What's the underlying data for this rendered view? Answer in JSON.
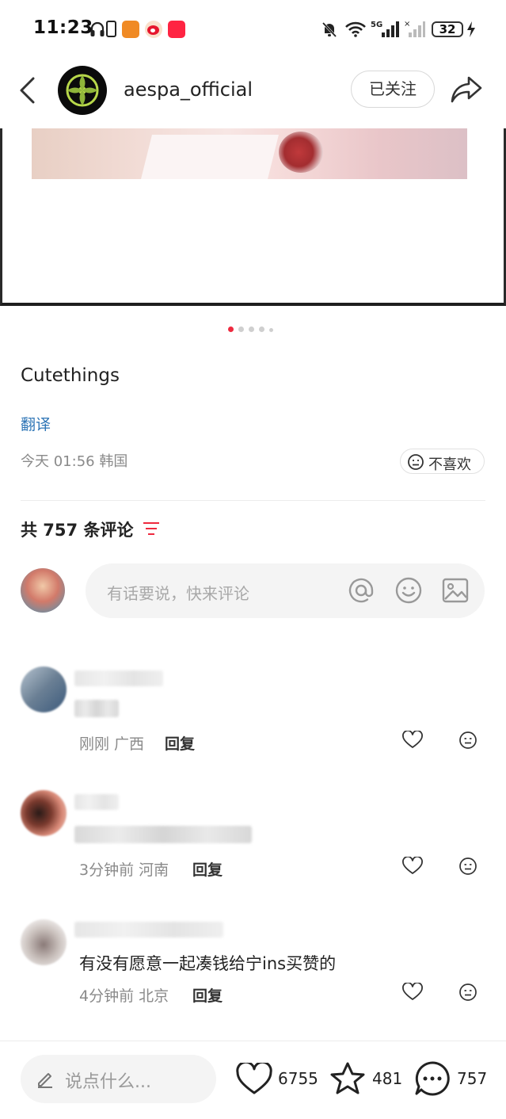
{
  "status_bar": {
    "time": "11:23",
    "battery": "32",
    "left_icons": [
      "headphones-icon",
      "battery-saver-icon",
      "app-notification-icon",
      "weibo-icon",
      "xiaohongshu-icon"
    ],
    "right_icons": [
      "mute-bell-icon",
      "wifi-icon",
      "signal-5g-icon",
      "signal-no-service-icon",
      "charging-icon"
    ]
  },
  "header": {
    "username": "aespa_official",
    "follow_label": "已关注"
  },
  "carousel": {
    "total": 5,
    "active": 0
  },
  "post": {
    "caption": "Cutethings",
    "translate_label": "翻译",
    "meta": "今天 01:56 韩国",
    "dislike_label": "不喜欢"
  },
  "comments_section": {
    "count_label": "共 757 条评论",
    "input_placeholder": "有话要说，快来评论"
  },
  "comments": [
    {
      "meta": "刚刚 广西",
      "reply_label": "回复",
      "text": ""
    },
    {
      "meta": "3分钟前 河南",
      "reply_label": "回复",
      "text": ""
    },
    {
      "meta": "4分钟前 北京",
      "reply_label": "回复",
      "text": "有没有愿意一起凑钱给宁ins买赞的"
    }
  ],
  "bottom_bar": {
    "placeholder": "说点什么...",
    "likes": "6755",
    "favorites": "481",
    "comments": "757"
  },
  "colors": {
    "accent_red": "#ee2a3f",
    "link_blue": "#2e75b6"
  }
}
